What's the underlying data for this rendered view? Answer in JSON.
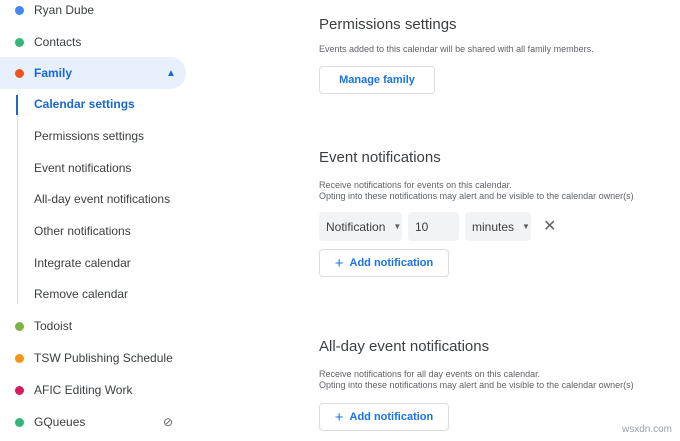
{
  "sidebar": {
    "calendars_top": [
      {
        "label": "Ryan Dube",
        "color": "#4285f4"
      },
      {
        "label": "Contacts",
        "color": "#33b679"
      },
      {
        "label": "Family",
        "color": "#f4511e"
      }
    ],
    "family_subitems": [
      "Calendar settings",
      "Permissions settings",
      "Event notifications",
      "All-day event notifications",
      "Other notifications",
      "Integrate calendar",
      "Remove calendar"
    ],
    "calendars_bottom": [
      {
        "label": "Todoist",
        "color": "#7cb342"
      },
      {
        "label": "TSW Publishing Schedule",
        "color": "#f6931c"
      },
      {
        "label": "AFIC Editing Work",
        "color": "#d81b60"
      },
      {
        "label": "GQueues",
        "color": "#33b679"
      }
    ]
  },
  "permissions": {
    "title": "Permissions settings",
    "desc": "Events added to this calendar will be shared with all family members.",
    "button": "Manage family"
  },
  "event_notifications": {
    "title": "Event notifications",
    "desc1": "Receive notifications for events on this calendar.",
    "desc2": "Opting into these notifications may alert and be visible to the calendar owner(s)",
    "type": "Notification",
    "value": "10",
    "unit": "minutes",
    "add": "Add notification"
  },
  "allday_notifications": {
    "title": "All-day event notifications",
    "desc1": "Receive notifications for all day events on this calendar.",
    "desc2": "Opting into these notifications may alert and be visible to the calendar owner(s)",
    "add": "Add notification"
  },
  "watermark": "wsxdn.com"
}
